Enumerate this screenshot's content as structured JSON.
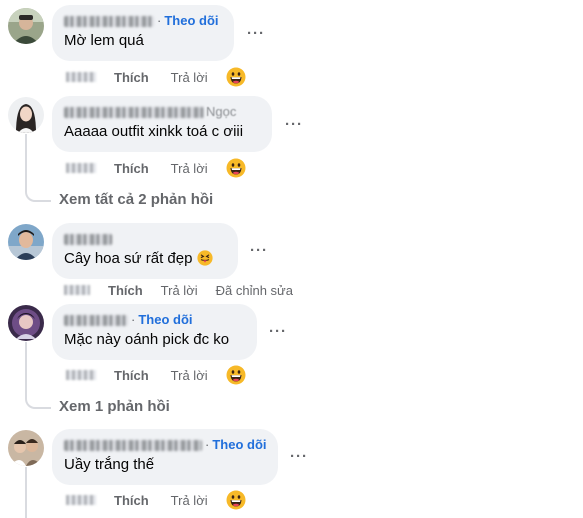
{
  "comments": [
    {
      "text": "Mờ lem quá",
      "follow_label": "Theo dõi",
      "actions": {
        "like": "Thích",
        "reply": "Trả lời"
      }
    },
    {
      "name_suffix": "Ngọc",
      "text": "Aaaaa outfit xinkk toá c ơiii",
      "actions": {
        "like": "Thích",
        "reply": "Trả lời"
      },
      "view_replies": "Xem tất cả 2 phản hồi"
    },
    {
      "text": "Cây hoa sứ rất đẹp",
      "actions": {
        "like": "Thích",
        "reply": "Trả lời",
        "edited": "Đã chỉnh sửa"
      }
    },
    {
      "text": "Mặc này oánh pick đc ko",
      "follow_label": "Theo dõi",
      "actions": {
        "like": "Thích",
        "reply": "Trả lời"
      },
      "view_replies": "Xem 1 phản hồi"
    },
    {
      "text": "Uầy trắng thế",
      "follow_label": "Theo dõi",
      "actions": {
        "like": "Thích",
        "reply": "Trả lời"
      }
    }
  ],
  "ui": {
    "more_glyph": "···",
    "separator": "·"
  },
  "colors": {
    "bubble": "#f0f2f5",
    "follow": "#216fdb",
    "secondary_text": "#65676b",
    "thread_line": "#d9dbe0"
  },
  "icons": {
    "more": "more-horizontal-icon",
    "reaction": "grinning-face-emoji-icon",
    "inline_emoji": "squinting-tongue-emoji-icon"
  }
}
